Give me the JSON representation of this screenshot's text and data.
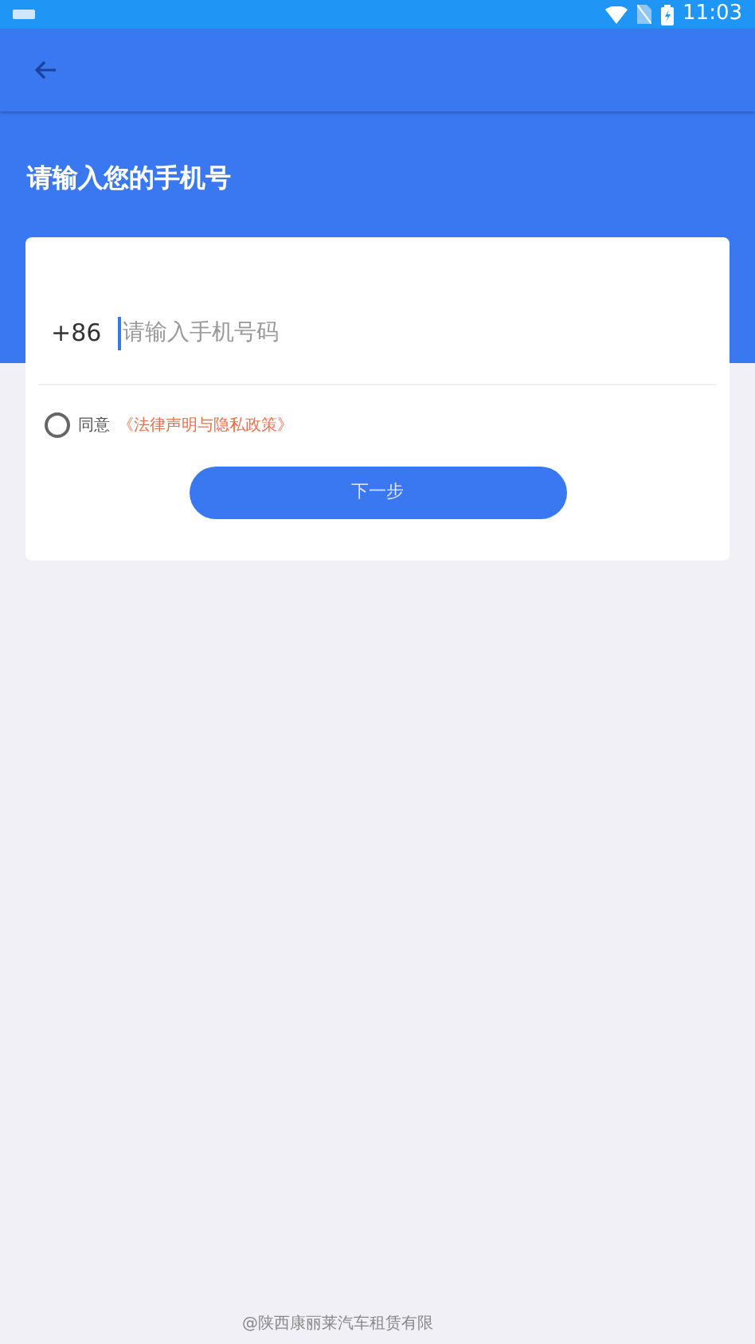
{
  "status_bar": {
    "time": "11:03"
  },
  "header": {
    "title": "请输入您的手机号"
  },
  "form": {
    "country_code": "+86",
    "phone_placeholder": "请输入手机号码",
    "agree_label": "同意",
    "policy_link": "《法律声明与隐私政策》",
    "agreed": false,
    "next_button": "下一步"
  },
  "footer": {
    "text": "@陕西康丽莱汽车租赁有限"
  }
}
